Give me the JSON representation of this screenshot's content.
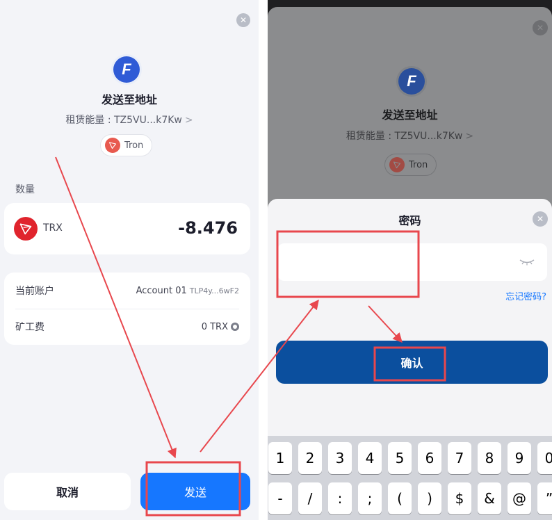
{
  "left": {
    "close_glyph": "✕",
    "brand_letter": "F",
    "title": "发送至地址",
    "subtitle": "租赁能量 : TZ5VU...k7Kw",
    "subtitle_chevron": ">",
    "chip_label": "Tron",
    "amount_label": "数量",
    "token_symbol": "TRX",
    "amount": "-8.476",
    "account_label": "当前账户",
    "account_name": "Account 01",
    "account_address": "TLP4y...6wF2",
    "fee_label": "矿工费",
    "fee_value": "0 TRX",
    "cancel_label": "取消",
    "send_label": "发送"
  },
  "right": {
    "close_glyph": "✕",
    "brand_letter": "F",
    "title": "发送至地址",
    "subtitle": "租赁能量 : TZ5VU...k7Kw",
    "subtitle_chevron": ">",
    "chip_label": "Tron",
    "password_title": "密码",
    "password_value": "",
    "forgot_label": "忘记密码?",
    "confirm_label": "确认",
    "keyboard_row1": [
      "1",
      "2",
      "3",
      "4",
      "5",
      "6",
      "7",
      "8",
      "9",
      "0"
    ],
    "keyboard_row2": [
      "-",
      "/",
      ":",
      ";",
      "(",
      ")",
      "$",
      "&",
      "@",
      "”"
    ]
  },
  "colors": {
    "primary_blue": "#1677ff",
    "confirm_blue": "#0b4f9e",
    "tron_red": "#e0242d",
    "annotation_red": "#e8474d"
  },
  "icons": {
    "close": "close-icon",
    "eye_hidden": "eye-closed-icon",
    "settings": "gear-icon",
    "token": "tron-icon"
  }
}
